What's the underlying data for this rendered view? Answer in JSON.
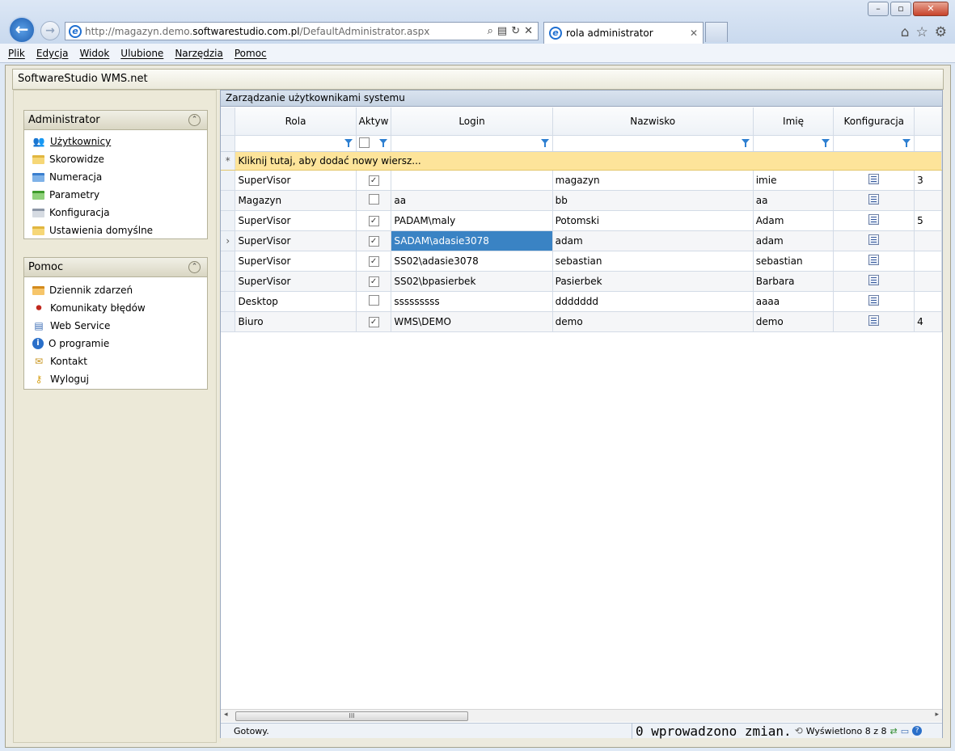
{
  "browser": {
    "url_prefix": "http://magazyn.demo.",
    "url_domain": "softwarestudio.com.pl",
    "url_path": "/DefaultAdministrator.aspx",
    "tab_title": "rola administrator"
  },
  "menu": [
    "Plik",
    "Edycja",
    "Widok",
    "Ulubione",
    "Narzędzia",
    "Pomoc"
  ],
  "app": {
    "title": "SoftwareStudio WMS.net"
  },
  "admin_pane": {
    "title": "Administrator",
    "items": [
      {
        "label": "Użytkownicy",
        "icon": "users-icon"
      },
      {
        "label": "Skorowidze",
        "icon": "folder-icon"
      },
      {
        "label": "Numeracja",
        "icon": "folder-icon"
      },
      {
        "label": "Parametry",
        "icon": "folder-icon"
      },
      {
        "label": "Konfiguracja",
        "icon": "folder-icon"
      },
      {
        "label": "Ustawienia domyślne",
        "icon": "folder-icon"
      }
    ]
  },
  "help_pane": {
    "title": "Pomoc",
    "items": [
      {
        "label": "Dziennik zdarzeń",
        "icon": "log-icon"
      },
      {
        "label": "Komunikaty błędów",
        "icon": "error-icon"
      },
      {
        "label": "Web Service",
        "icon": "web-service-icon"
      },
      {
        "label": "O programie",
        "icon": "info-icon"
      },
      {
        "label": "Kontakt",
        "icon": "mail-icon"
      },
      {
        "label": "Wyloguj",
        "icon": "key-icon"
      }
    ]
  },
  "main": {
    "title": "Zarządzanie użytkownikami systemu",
    "columns": [
      "Rola",
      "Aktyw",
      "Login",
      "Nazwisko",
      "Imię",
      "Konfiguracja"
    ],
    "add_row_text": "Kliknij tutaj, aby dodać nowy wiersz...",
    "rows": [
      {
        "rola": "SuperVisor",
        "aktyw": true,
        "login": "",
        "nazwisko": "magazyn",
        "imie": "imie",
        "extra": "3"
      },
      {
        "rola": "Magazyn",
        "aktyw": false,
        "login": "aa",
        "nazwisko": "bb",
        "imie": "aa",
        "extra": ""
      },
      {
        "rola": "SuperVisor",
        "aktyw": true,
        "login": "PADAM\\maly",
        "nazwisko": "Potomski",
        "imie": "Adam",
        "extra": "5"
      },
      {
        "rola": "SuperVisor",
        "aktyw": true,
        "login": "SADAM\\adasie3078",
        "nazwisko": "adam",
        "imie": "adam",
        "extra": "",
        "selected": true
      },
      {
        "rola": "SuperVisor",
        "aktyw": true,
        "login": "SS02\\adasie3078",
        "nazwisko": "sebastian",
        "imie": "sebastian",
        "extra": ""
      },
      {
        "rola": "SuperVisor",
        "aktyw": true,
        "login": "SS02\\bpasierbek",
        "nazwisko": "Pasierbek",
        "imie": "Barbara",
        "extra": ""
      },
      {
        "rola": "Desktop",
        "aktyw": false,
        "login": "sssssssss",
        "nazwisko": "ddddddd",
        "imie": "aaaa",
        "extra": ""
      },
      {
        "rola": "Biuro",
        "aktyw": true,
        "login": "WMS\\DEMO",
        "nazwisko": "demo",
        "imie": "demo",
        "extra": "4"
      }
    ]
  },
  "status": {
    "ready": "Gotowy.",
    "changes": "0 wprowadzono zmian.",
    "shown": "Wyświetlono 8 z 8"
  }
}
